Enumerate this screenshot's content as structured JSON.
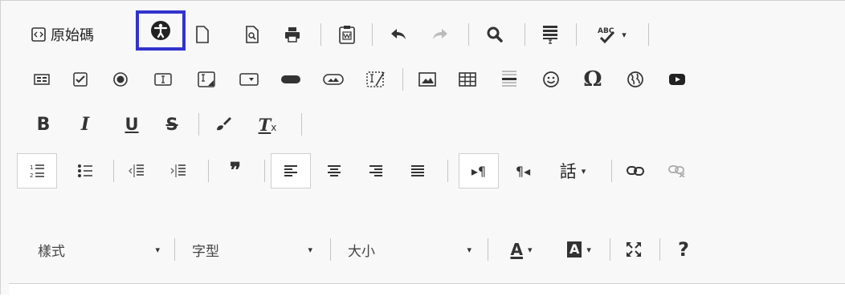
{
  "toolbar": {
    "source_label": "原始碼",
    "spellcheck_glyph": "ABC",
    "bold_glyph": "B",
    "italic_glyph": "I",
    "underline_glyph": "U",
    "strike_glyph": "S",
    "removeformat_glyph": "T",
    "removeformat_sub": "x",
    "blockquote_glyph": "❞",
    "omega_glyph": "Ω",
    "pilcrow_ltr": "▸¶",
    "pilcrow_rtl": "¶◂",
    "language_label": "話",
    "styles_label": "樣式",
    "format_label": "字型",
    "size_label": "大小",
    "textcolor_glyph": "A",
    "bgcolor_glyph": "A",
    "help_glyph": "?",
    "dropdown_arrow": "▾"
  }
}
